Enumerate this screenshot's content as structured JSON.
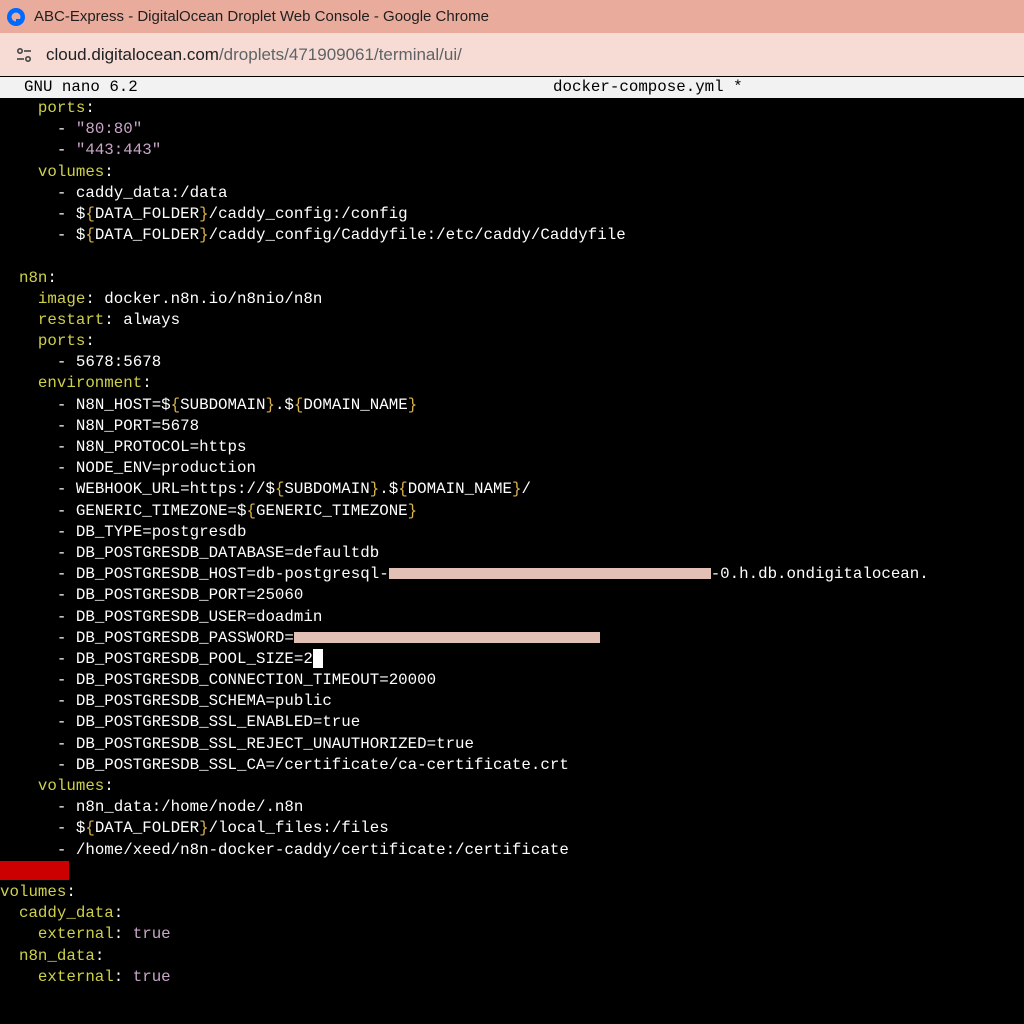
{
  "window": {
    "title": "ABC-Express - DigitalOcean Droplet Web Console - Google Chrome"
  },
  "address": {
    "host": "cloud.digitalocean.com",
    "path": "/droplets/471909061/terminal/ui/"
  },
  "nano": {
    "version": "GNU nano 6.2",
    "filename": "docker-compose.yml *"
  },
  "editor": {
    "l01": "ports",
    "l02": "\"80:80\"",
    "l03": "\"443:443\"",
    "l04": "volumes",
    "l05": "caddy_data:/data",
    "l06a": "$",
    "l06b": "{",
    "l06c": "DATA_FOLDER",
    "l06d": "}",
    "l06e": "/caddy_config:/config",
    "l07a": "$",
    "l07b": "{",
    "l07c": "DATA_FOLDER",
    "l07d": "}",
    "l07e": "/caddy_config/Caddyfile:/etc/caddy/Caddyfile",
    "l09": "n8n",
    "l10k": "image",
    "l10v": "docker.n8n.io/n8nio/n8n",
    "l11k": "restart",
    "l11v": "always",
    "l12": "ports",
    "l13": "5678:5678",
    "l14": "environment",
    "l15a": "N8N_HOST=$",
    "l15b": "{",
    "l15c": "SUBDOMAIN",
    "l15d": "}",
    "l15e": ".$",
    "l15f": "{",
    "l15g": "DOMAIN_NAME",
    "l15h": "}",
    "l16": "N8N_PORT=5678",
    "l17": "N8N_PROTOCOL=https",
    "l18": "NODE_ENV=production",
    "l19a": "WEBHOOK_URL=https://$",
    "l19b": "{",
    "l19c": "SUBDOMAIN",
    "l19d": "}",
    "l19e": ".$",
    "l19f": "{",
    "l19g": "DOMAIN_NAME",
    "l19h": "}",
    "l19i": "/",
    "l20a": "GENERIC_TIMEZONE=$",
    "l20b": "{",
    "l20c": "GENERIC_TIMEZONE",
    "l20d": "}",
    "l21": "DB_TYPE=postgresdb",
    "l22": "DB_POSTGRESDB_DATABASE=defaultdb",
    "l23a": "DB_POSTGRESDB_HOST=db-postgresql-",
    "l23b": "-0.h.db.ondigitalocean.",
    "l24": "DB_POSTGRESDB_PORT=25060",
    "l25": "DB_POSTGRESDB_USER=doadmin",
    "l26": "DB_POSTGRESDB_PASSWORD=",
    "l27": "DB_POSTGRESDB_POOL_SIZE=2",
    "l28": "DB_POSTGRESDB_CONNECTION_TIMEOUT=20000",
    "l29": "DB_POSTGRESDB_SCHEMA=public",
    "l30": "DB_POSTGRESDB_SSL_ENABLED=true",
    "l31": "DB_POSTGRESDB_SSL_REJECT_UNAUTHORIZED=true",
    "l32": "DB_POSTGRESDB_SSL_CA=/certificate/ca-certificate.crt",
    "l33": "volumes",
    "l34": "n8n_data:/home/node/.n8n",
    "l35a": "$",
    "l35b": "{",
    "l35c": "DATA_FOLDER",
    "l35d": "}",
    "l35e": "/local_files:/files",
    "l36": "/home/xeed/n8n-docker-caddy/certificate:/certificate",
    "l38": "volumes",
    "l39": "caddy_data",
    "l40k": "external",
    "l40v": "true",
    "l41": "n8n_data",
    "l42k": "external",
    "l42v": "true",
    "colon": ":",
    "dash": "-"
  },
  "colors": {
    "key": "#cfd04a",
    "string": "#c9a6c8",
    "brace": "#d9b24a",
    "titlebar": "#e8ab9c",
    "addressbar": "#f6dcd4"
  },
  "icons": {
    "app": "digitalocean-icon",
    "site": "site-settings-icon"
  }
}
